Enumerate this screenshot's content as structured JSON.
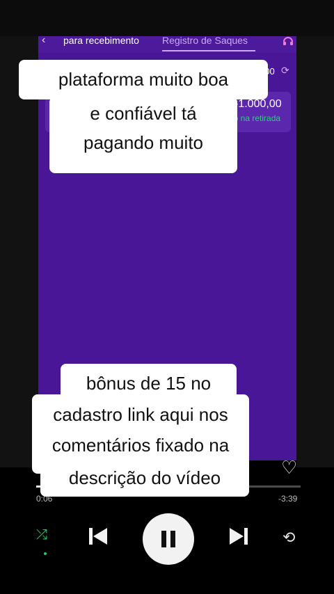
{
  "app": {
    "tab_back": "‹",
    "tab_left": "para recebimento",
    "tab_active": "Registro de Saques",
    "support_icon": "headset-icon",
    "balance": "000,00",
    "refresh_icon": "refresh-icon",
    "withdrawal": {
      "amount": "-1.000,00",
      "status": "esso na retirada"
    }
  },
  "captions": {
    "top_line1": "plataforma muito boa",
    "top_line2": "e confiável tá pagando muito",
    "bottom_line1": "bônus de 15 no",
    "bottom_line2": "cadastro link aqui nos comentários fixado na",
    "bottom_line3": "descrição do vídeo"
  },
  "player": {
    "time_elapsed": "0:06",
    "time_remaining": "-3:39",
    "progress_fraction": 0.03,
    "icons": [
      "heart-icon",
      "shuffle-icon",
      "previous-icon",
      "pause-icon",
      "next-icon",
      "repeat-icon"
    ],
    "colors": {
      "accent": "#28c56a",
      "screen_bg": "#4a1698"
    }
  }
}
